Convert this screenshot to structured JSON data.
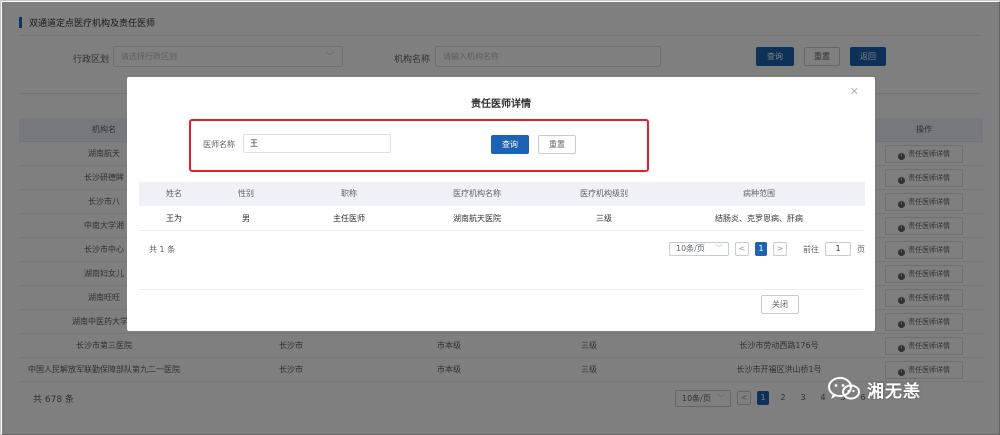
{
  "page": {
    "title": "双通道定点医疗机构及责任医师"
  },
  "filters": {
    "region_label": "行政区划",
    "region_placeholder": "请选择行政区划",
    "org_label": "机构名称",
    "org_placeholder": "请输入机构名称",
    "search_label": "查询",
    "reset_label": "重置",
    "back_label": "返回"
  },
  "table": {
    "headers": {
      "name": "机构名",
      "op": "操作"
    },
    "rows": [
      {
        "name": "湖南航天",
        "region": "",
        "level": "",
        "grade": "",
        "address": "",
        "op": "责任医师详情"
      },
      {
        "name": "长沙研德眸",
        "region": "",
        "level": "",
        "grade": "",
        "address": "",
        "op": "责任医师详情"
      },
      {
        "name": "长沙市八",
        "region": "",
        "level": "",
        "grade": "",
        "address": "",
        "op": "责任医师详情"
      },
      {
        "name": "中南大学湘",
        "region": "",
        "level": "",
        "grade": "",
        "address": "",
        "op": "责任医师详情"
      },
      {
        "name": "长沙市中心",
        "region": "",
        "level": "",
        "grade": "",
        "address": "",
        "op": "责任医师详情"
      },
      {
        "name": "湖南妇女儿",
        "region": "",
        "level": "",
        "grade": "",
        "address": "",
        "op": "责任医师详情"
      },
      {
        "name": "湖南旺旺",
        "region": "",
        "level": "",
        "grade": "",
        "address": "",
        "op": "责任医师详情"
      },
      {
        "name": "湖南中医药大学第",
        "region": "",
        "level": "",
        "grade": "",
        "address": "",
        "op": "责任医师详情"
      },
      {
        "name": "长沙市第三医院",
        "region": "长沙市",
        "level": "市本级",
        "grade": "三级",
        "address": "长沙市劳动西路176号",
        "op": "责任医师详情"
      },
      {
        "name": "中国人民解放军联勤保障部队第九二一医院",
        "region": "长沙市",
        "level": "市本级",
        "grade": "三级",
        "address": "长沙市开福区洪山桥1号",
        "op": "责任医师详情"
      }
    ],
    "total": "共 678 条",
    "pager": {
      "size": "10条/页",
      "pages": [
        "1",
        "2",
        "3",
        "4",
        "5",
        "6"
      ],
      "current": "1"
    }
  },
  "dialog": {
    "title": "责任医师详情",
    "field_label": "医师名称",
    "field_value": "王",
    "search_label": "查询",
    "reset_label": "重置",
    "columns": [
      "姓名",
      "性别",
      "职称",
      "医疗机构名称",
      "医疗机构级别",
      "病种范围"
    ],
    "rows": [
      {
        "name": "王为",
        "gender": "男",
        "title": "主任医师",
        "org": "湖南航天医院",
        "grade": "三级",
        "scope": "结肠炎、克罗恩病、肝病"
      }
    ],
    "total": "共 1 条",
    "pager": {
      "size": "10条/页",
      "current": "1",
      "goto_label": "前往",
      "goto_value": "1",
      "page_suffix": "页"
    },
    "close_label": "关闭"
  },
  "watermark": {
    "text": "湘无恙",
    "icon": "wechat-icon"
  },
  "colors": {
    "primary": "#1d63b3",
    "highlight": "#e3202a"
  }
}
